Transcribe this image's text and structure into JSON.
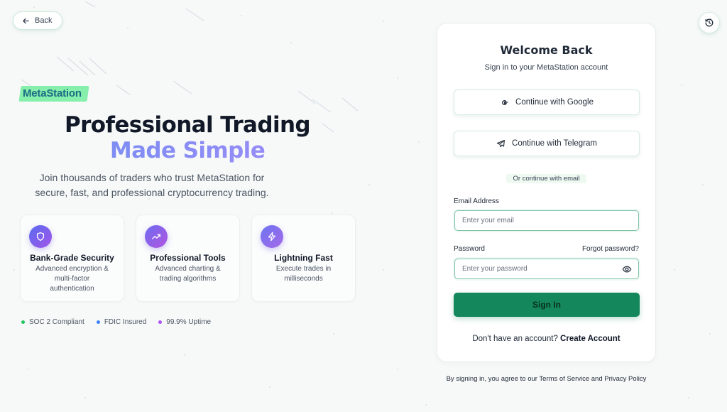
{
  "nav": {
    "back_label": "Back"
  },
  "brand": {
    "logo_text": "MetaStation"
  },
  "hero": {
    "title_line1": "Professional Trading",
    "title_line2": "Made Simple",
    "subtitle_line1": "Join thousands of traders who trust MetaStation for",
    "subtitle_line2": "secure, fast, and professional cryptocurrency trading."
  },
  "features": [
    {
      "icon": "shield-icon",
      "title": "Bank-Grade Security",
      "desc_line1": "Advanced encryption &",
      "desc_line2": "multi-factor",
      "desc_line3": "authentication"
    },
    {
      "icon": "trending-up-icon",
      "title": "Professional Tools",
      "desc_line1": "Advanced charting &",
      "desc_line2": "trading algorithms"
    },
    {
      "icon": "lightning-icon",
      "title": "Lightning Fast",
      "desc_line1": "Execute trades in",
      "desc_line2": "milliseconds"
    }
  ],
  "badges": [
    {
      "label": "SOC 2 Compliant",
      "color": "#22c55e"
    },
    {
      "label": "FDIC Insured",
      "color": "#3b82f6"
    },
    {
      "label": "99.9% Uptime",
      "color": "#a855f7"
    }
  ],
  "login": {
    "title": "Welcome Back",
    "subtitle": "Sign in to your MetaStation account",
    "google_label": "Continue with Google",
    "telegram_label": "Continue with Telegram",
    "divider_label": "Or continue with email",
    "email_label": "Email Address",
    "email_placeholder": "Enter your email",
    "email_value": "",
    "password_label": "Password",
    "forgot_label": "Forgot password?",
    "password_placeholder": "Enter your password",
    "password_value": "",
    "signin_label": "Sign In",
    "no_account_text": "Don't have an account?",
    "create_account_label": "Create Account"
  },
  "terms_text": "By signing in, you agree to our Terms of Service and Privacy Policy",
  "colors": {
    "accent": "#14885c",
    "gradient_start": "#6d8ef0",
    "gradient_end": "#a78bfa"
  }
}
